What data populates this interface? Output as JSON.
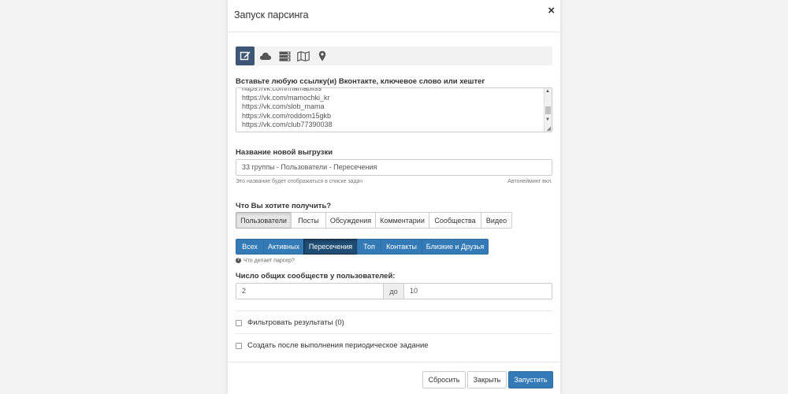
{
  "modal": {
    "title": "Запуск парсинга",
    "close": "×"
  },
  "sources": [
    {
      "icon": "edit-icon",
      "active": true
    },
    {
      "icon": "cloud-icon",
      "active": false
    },
    {
      "icon": "server-icon",
      "active": false
    },
    {
      "icon": "map-icon",
      "active": false
    },
    {
      "icon": "map-marker-icon",
      "active": false
    }
  ],
  "links": {
    "label": "Вставьте любую ссылку(и) Вконтакте, ключевое слово или хештег",
    "lines": [
      "https://vk.com/mamabliss",
      "https://vk.com/mamochki_kr",
      "https://vk.com/slob_mama",
      "https://vk.com/roddom15gkb",
      "https://vk.com/club77390038"
    ]
  },
  "name_field": {
    "label": "Название новой выгрузки",
    "value": "33 группы - Пользователи - Пересечения",
    "help_left": "Это название будет отображаться в списке задач",
    "help_right": "Автонейминг вкл."
  },
  "get": {
    "label": "Что Вы хотите получить?",
    "options": [
      "Пользователи",
      "Посты",
      "Обсуждения",
      "Комментарии",
      "Сообщества",
      "Видео"
    ],
    "selected": "Пользователи"
  },
  "mode": {
    "options": [
      "Всех",
      "Активных",
      "Пересечения",
      "Топ",
      "Контакты",
      "Близкие и Друзья"
    ],
    "selected": "Пересечения",
    "help_link": "Что делает парсер?"
  },
  "common": {
    "label": "Число общих сообществ у пользователей:",
    "from_value": "2",
    "to_label": "до",
    "to_value": "10"
  },
  "options": {
    "filter_label": "Фильтровать результаты (0)",
    "periodic_label": "Создать после выполнения периодическое задание"
  },
  "footer": {
    "reset": "Сбросить",
    "close": "Закрыть",
    "run": "Запустить"
  },
  "colors": {
    "primary": "#337ab7",
    "primary_active": "#204d74",
    "source_active": "#3e5676"
  }
}
